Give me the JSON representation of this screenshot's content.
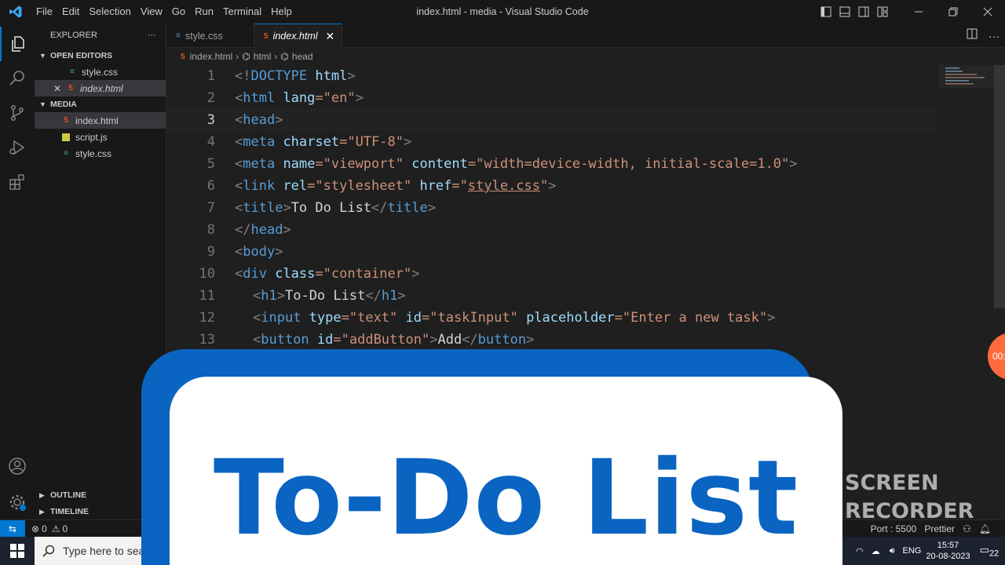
{
  "window": {
    "title": "index.html - media - Visual Studio Code"
  },
  "menu": [
    "File",
    "Edit",
    "Selection",
    "View",
    "Go",
    "Run",
    "Terminal",
    "Help"
  ],
  "sidebar": {
    "header": "EXPLORER",
    "more": "···",
    "open_editors": {
      "label": "OPEN EDITORS",
      "items": [
        {
          "name": "style.css",
          "type": "css"
        },
        {
          "name": "index.html",
          "type": "html",
          "close": "✕"
        }
      ]
    },
    "folder": {
      "label": "MEDIA",
      "items": [
        {
          "name": "index.html",
          "type": "html"
        },
        {
          "name": "script.js",
          "type": "js"
        },
        {
          "name": "style.css",
          "type": "css"
        }
      ]
    },
    "outline": "OUTLINE",
    "timeline": "TIMELINE"
  },
  "tabs": [
    {
      "label": "style.css",
      "type": "css"
    },
    {
      "label": "index.html",
      "type": "html",
      "close": "✕"
    }
  ],
  "breadcrumb": [
    "index.html",
    "html",
    "head"
  ],
  "code_lines": [
    {
      "n": "1"
    },
    {
      "n": "2"
    },
    {
      "n": "3"
    },
    {
      "n": "4"
    },
    {
      "n": "5"
    },
    {
      "n": "6"
    },
    {
      "n": "7"
    },
    {
      "n": "8"
    },
    {
      "n": "9"
    },
    {
      "n": "10"
    },
    {
      "n": "11"
    },
    {
      "n": "12"
    },
    {
      "n": "13"
    }
  ],
  "code": {
    "l1": {
      "a": "<!",
      "b": "DOCTYPE",
      "c": " html",
      "d": ">"
    },
    "l2": {
      "a": "<",
      "b": "html",
      "c": " lang",
      "d": "=\"en\"",
      "e": ">"
    },
    "l3": {
      "a": "<",
      "b": "head",
      "c": ">"
    },
    "l4": {
      "a": "<",
      "b": "meta",
      "c": " charset",
      "d": "=\"UTF-8\"",
      "e": ">"
    },
    "l5": {
      "a": "<",
      "b": "meta",
      "c": " name",
      "d": "=\"viewport\"",
      "e": " content",
      "f": "=\"width=device-width, initial-scale=1.0\"",
      "g": ">"
    },
    "l6": {
      "a": "<",
      "b": "link",
      "c": " rel",
      "d": "=\"stylesheet\"",
      "e": " href",
      "f": "=\"",
      "g": "style.css",
      "h": "\"",
      "i": ">"
    },
    "l7": {
      "a": "<",
      "b": "title",
      "c": ">",
      "d": "To Do List",
      "e": "</",
      "f": "title",
      "g": ">"
    },
    "l8": {
      "a": "</",
      "b": "head",
      "c": ">"
    },
    "l9": {
      "a": "<",
      "b": "body",
      "c": ">"
    },
    "l10": {
      "a": "<",
      "b": "div",
      "c": " class",
      "d": "=\"container\"",
      "e": ">"
    },
    "l11": {
      "a": "<",
      "b": "h1",
      "c": ">",
      "d": "To-Do List",
      "e": "</",
      "f": "h1",
      "g": ">"
    },
    "l12": {
      "a": "<",
      "b": "input",
      "c": " type",
      "d": "=\"text\"",
      "e": " id",
      "f": "=\"taskInput\"",
      "g": " placeholder",
      "h": "=\"Enter a new task\"",
      "i": ">"
    },
    "l13": {
      "a": "<",
      "b": "button",
      "c": " id",
      "d": "=\"addButton\"",
      "e": ">",
      "f": "Add",
      "g": "</",
      "h": "button",
      "i": ">"
    }
  },
  "status": {
    "errors": "0",
    "warnings": "0",
    "port": "Port : 5500",
    "prettier": "Prettier"
  },
  "taskbar": {
    "search_placeholder": "Type here to search",
    "lang": "ENG",
    "time": "15:57",
    "date": "20-08-2023",
    "notifications": "22"
  },
  "overlay": {
    "title": "To-Do List",
    "watermark_line1": "SCREEN",
    "watermark_line2": "RECORDER",
    "recording": "00:"
  },
  "colors": {
    "accent": "#0078d4",
    "overlay_blue": "#0a64c2",
    "html_icon": "#e44d26",
    "css_icon": "#519aba",
    "js_icon": "#cbcb41"
  }
}
